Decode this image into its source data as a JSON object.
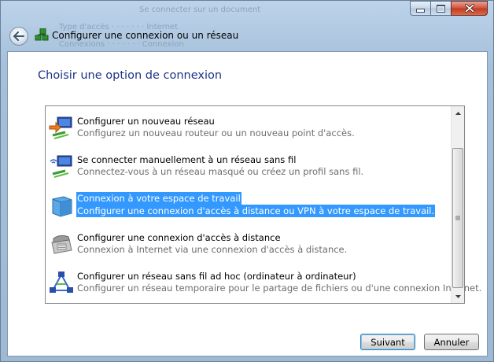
{
  "window": {
    "title": "Configurer une connexion ou un réseau",
    "controls": {
      "minimize": "minimize-icon",
      "maximize": "maximize-icon",
      "close": "close-icon"
    }
  },
  "heading": "Choisir une option de connexion",
  "options": [
    {
      "title": "Configurer un nouveau réseau",
      "description": "Configurez un nouveau routeur ou un nouveau point d'accès.",
      "icon": "new-network-icon",
      "selected": false
    },
    {
      "title": "Se connecter manuellement à un réseau sans fil",
      "description": "Connectez-vous à un réseau masqué ou créez un profil sans fil.",
      "icon": "wireless-network-icon",
      "selected": false
    },
    {
      "title": "Connexion à votre espace de travail",
      "description": "Configurer une connexion d'accès à distance ou VPN à votre espace de travail.",
      "icon": "workplace-vpn-icon",
      "selected": true
    },
    {
      "title": "Configurer une connexion d'accès à distance",
      "description": "Connexion à Internet via une connexion d'accès à distance.",
      "icon": "dialup-telephone-icon",
      "selected": false
    },
    {
      "title": "Configurer un réseau sans fil ad hoc (ordinateur à ordinateur)",
      "description": "Configurer un réseau temporaire pour le partage de fichiers ou d'une connexion Internet.",
      "icon": "adhoc-network-icon",
      "selected": false
    }
  ],
  "buttons": {
    "next": "Suivant",
    "cancel": "Annuler"
  },
  "colors": {
    "heading": "#1e3287",
    "selection": "#3399ff",
    "frame": "#a9c3dc"
  }
}
